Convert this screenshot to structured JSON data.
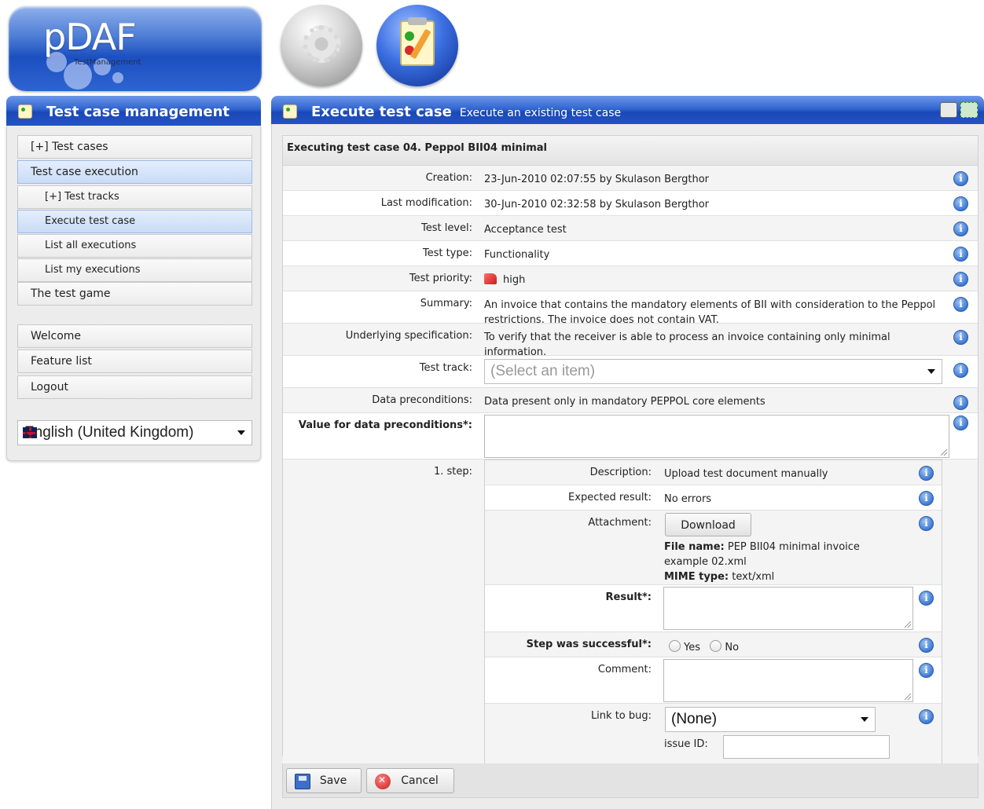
{
  "header": {
    "logo_text": "pDAF",
    "logo_sub": "TestManagement"
  },
  "sidebar": {
    "title": "Test case management",
    "items": [
      {
        "label": "[+] Test cases"
      },
      {
        "label": "Test case execution"
      },
      {
        "label": "[+] Test tracks"
      },
      {
        "label": "Execute test case"
      },
      {
        "label": "List all executions"
      },
      {
        "label": "List my executions"
      },
      {
        "label": "The test game"
      },
      {
        "label": "Welcome"
      },
      {
        "label": "Feature list"
      },
      {
        "label": "Logout"
      }
    ],
    "language": "English (United Kingdom)"
  },
  "main": {
    "title": "Execute test case",
    "subtitle": "Execute an existing test case",
    "form_title": "Executing test case 04. Peppol BII04 minimal",
    "fields": {
      "creation_label": "Creation:",
      "creation_value": "23-Jun-2010 02:07:55 by Skulason Bergthor",
      "modification_label": "Last modification:",
      "modification_value": "30-Jun-2010 02:32:58 by Skulason Bergthor",
      "level_label": "Test level:",
      "level_value": "Acceptance test",
      "type_label": "Test type:",
      "type_value": "Functionality",
      "priority_label": "Test priority:",
      "priority_value": "high",
      "summary_label": "Summary:",
      "summary_value": "An invoice that contains the mandatory elements of BII with consideration to the Peppol restrictions. The invoice does not contain VAT.",
      "spec_label": "Underlying specification:",
      "spec_value": "To verify that the receiver is able to process an invoice containing only minimal information.",
      "track_label": "Test track:",
      "track_placeholder": "(Select an item)",
      "precond_label": "Data preconditions:",
      "precond_value": "Data present only in mandatory PEPPOL core elements",
      "precond_input_label": "Value for data preconditions*:",
      "step_label": "1. step:"
    },
    "step": {
      "description_label": "Description:",
      "description_value": "Upload test document manually",
      "expected_label": "Expected result:",
      "expected_value": "No errors",
      "attachment_label": "Attachment:",
      "download_button": "Download",
      "file_name_label": "File name:",
      "file_name_value": "PEP BII04 minimal invoice example 02.xml",
      "mime_label": "MIME type:",
      "mime_value": "text/xml",
      "result_label": "Result*:",
      "success_label": "Step was successful*:",
      "yes_label": "Yes",
      "no_label": "No",
      "comment_label": "Comment:",
      "bug_label": "Link to bug:",
      "bug_select": "(None)",
      "issue_label": "issue ID:"
    },
    "buttons": {
      "save": "Save",
      "cancel": "Cancel"
    }
  },
  "icons": {
    "info": "i"
  }
}
